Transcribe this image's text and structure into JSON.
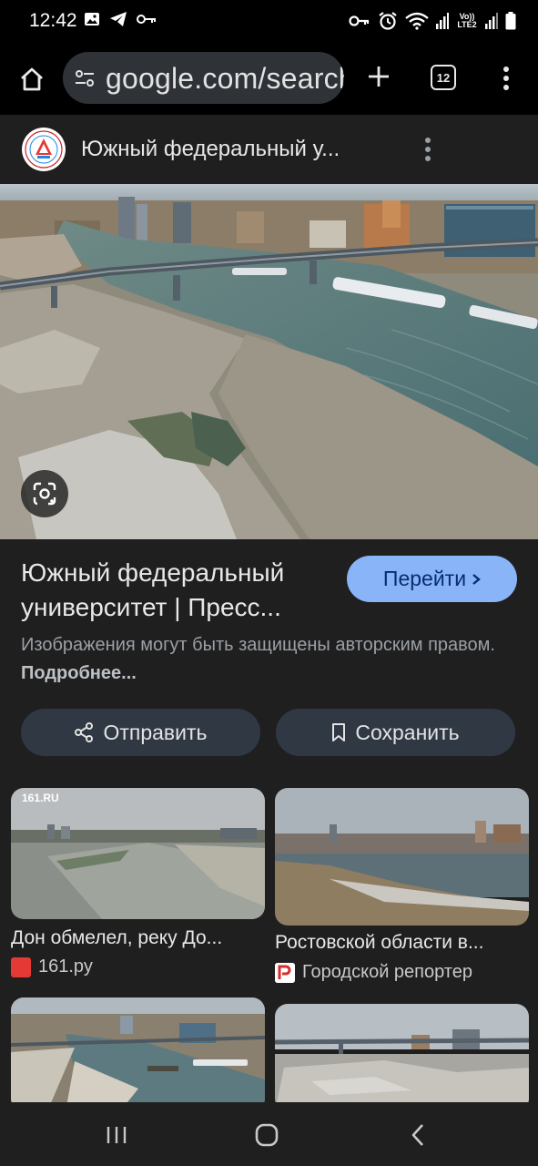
{
  "status_bar": {
    "time": "12:42",
    "left_icons": [
      "image-icon",
      "telegram-icon",
      "key-icon"
    ],
    "right_icons": [
      "vpn-key-icon",
      "alarm-icon",
      "wifi-icon",
      "signal-icon",
      "volte-icon",
      "signal-icon",
      "battery-icon"
    ],
    "network_label": "Vo)) LTE2"
  },
  "toolbar": {
    "url": "google.com/search",
    "tab_count": "12"
  },
  "page_header": {
    "title": "Южный федеральный у..."
  },
  "result": {
    "title": "Южный федеральный университет | Пресс...",
    "visit_label": "Перейти",
    "copyright_text": "Изображения могут быть защищены авторским правом.",
    "more_link": "Подробнее..."
  },
  "actions": {
    "share_label": "Отправить",
    "save_label": "Сохранить"
  },
  "related": [
    {
      "title": "Дон обмелел, реку До...",
      "source": "161.ру",
      "watermark": "161.RU",
      "favicon_color": "#e53935"
    },
    {
      "title": "Ростовской области в...",
      "source": "Городской репортер",
      "favicon_color": "#d32f2f"
    },
    {
      "title": "",
      "source": ""
    },
    {
      "title": "",
      "source": ""
    }
  ],
  "colors": {
    "background": "#1f1f1f",
    "accent_button": "#8ab4f8",
    "tonal_button": "#303844"
  }
}
